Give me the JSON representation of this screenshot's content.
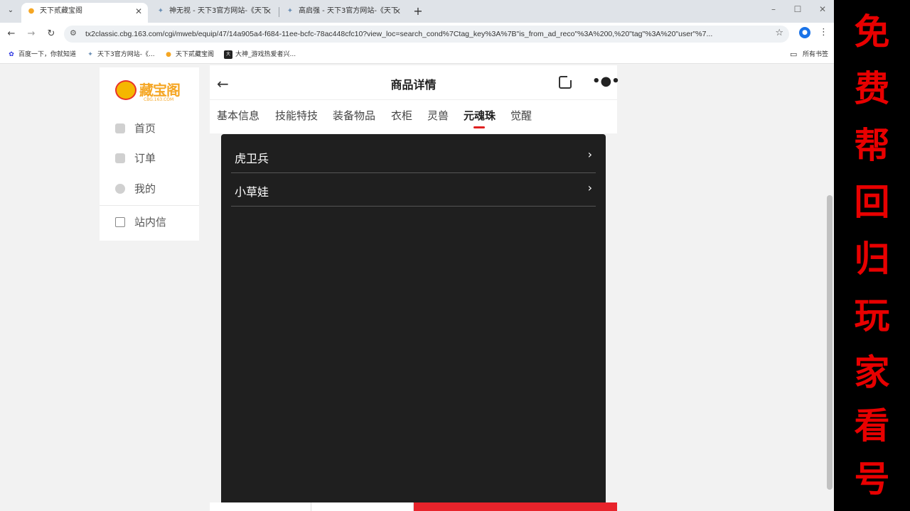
{
  "browser": {
    "tabs": [
      {
        "title": "天下贰藏宝阁",
        "active": true
      },
      {
        "title": "神无视 - 天下3官方网站-《天下",
        "active": false
      },
      {
        "title": "高启强 - 天下3官方网站-《天下",
        "active": false
      }
    ],
    "new_tab": "+",
    "url": "tx2classic.cbg.163.com/cgi/mweb/equip/47/14a905a4-f684-11ee-bcfc-78ac448cfc10?view_loc=search_cond%7Ctag_key%3A%7B\"is_from_ad_reco\"%3A%200,%20\"tag\"%3A%20\"user\"%7...",
    "bookmarks": [
      {
        "label": "百度一下，你就知道",
        "icon": "baidu-icon"
      },
      {
        "label": "天下3官方网站-《...",
        "icon": "tx3-icon"
      },
      {
        "label": "天下贰藏宝阁",
        "icon": "cbg-icon"
      },
      {
        "label": "大神_游戏热爱者兴...",
        "icon": "dashen-icon"
      }
    ],
    "bookmarks_folder": "所有书签"
  },
  "sidebar": {
    "logo_text": "藏宝阁",
    "logo_sub": "CBG.163.COM",
    "items": [
      {
        "label": "首页",
        "icon": "home-icon"
      },
      {
        "label": "订单",
        "icon": "order-icon"
      },
      {
        "label": "我的",
        "icon": "user-icon"
      },
      {
        "label": "站内信",
        "icon": "mail-icon"
      }
    ]
  },
  "header": {
    "title": "商品详情",
    "tabs": [
      "基本信息",
      "技能特技",
      "装备物品",
      "衣柜",
      "灵兽",
      "元魂珠",
      "觉醒"
    ],
    "active_tab": "元魂珠"
  },
  "panel": {
    "rows": [
      {
        "label": "虎卫兵"
      },
      {
        "label": "小草娃"
      }
    ]
  },
  "banner": {
    "chars": [
      "免",
      "费",
      "帮",
      "回",
      "归",
      "玩",
      "家",
      "看",
      "号"
    ],
    "color": "#e80000"
  }
}
